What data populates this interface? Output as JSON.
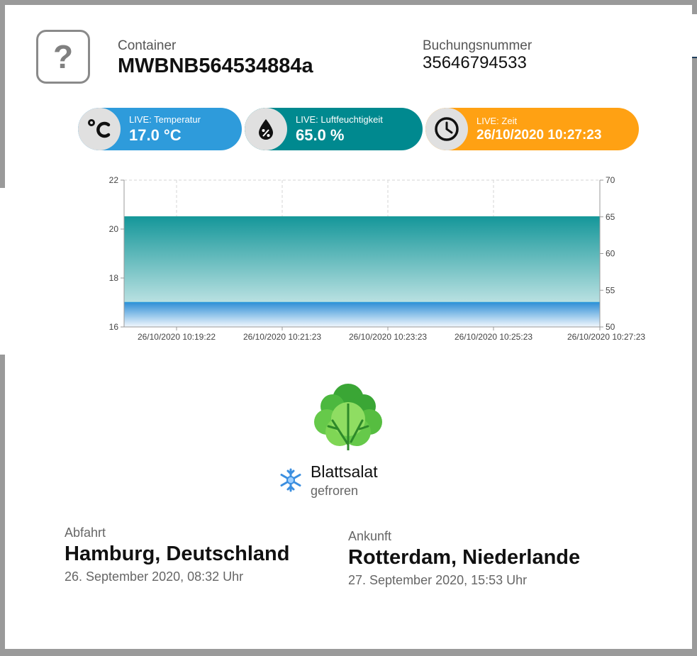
{
  "header": {
    "container_label": "Container",
    "container_value": "MWBNB564534884a",
    "booking_label": "Buchungsnummer",
    "booking_value": "35646794533",
    "unknown_icon": "question-mark-icon"
  },
  "live": {
    "temperature": {
      "label": "LIVE: Temperatur",
      "value": "17.0 °C",
      "icon": "celsius-icon",
      "color": "#2e9bdb"
    },
    "humidity": {
      "label": "LIVE: Luftfeuchtigkeit",
      "value": "65.0 %",
      "icon": "humidity-drop-icon",
      "color": "#00898f"
    },
    "time": {
      "label": "LIVE: Zeit",
      "value": "26/10/2020 10:27:23",
      "icon": "clock-icon",
      "color": "#ffa113"
    }
  },
  "chart_data": {
    "type": "area",
    "x": [
      "26/10/2020 10:19:22",
      "26/10/2020 10:21:23",
      "26/10/2020 10:23:23",
      "26/10/2020 10:25:23",
      "26/10/2020 10:27:23"
    ],
    "y_left_ticks": [
      "16",
      "18",
      "20",
      "22"
    ],
    "y_right_ticks": [
      "50",
      "55",
      "60",
      "65",
      "70"
    ],
    "ylim_left": [
      16,
      22
    ],
    "ylim_right": [
      50,
      70
    ],
    "series": [
      {
        "axis": "right",
        "values": [
          65,
          65,
          65,
          65,
          65
        ],
        "color": "#1a9a9a"
      },
      {
        "axis": "left",
        "values": [
          17,
          17,
          17,
          17,
          17
        ],
        "color": "#2e9bdb"
      }
    ],
    "grid": true
  },
  "product": {
    "name": "Blattsalat",
    "state": "gefroren",
    "image": "lettuce-icon",
    "state_icon": "snowflake-icon"
  },
  "departure": {
    "label": "Abfahrt",
    "city": "Hamburg, Deutschland",
    "date": "26. September 2020, 08:32 Uhr"
  },
  "arrival": {
    "label": "Ankunft",
    "city": "Rotterdam, Niederlande",
    "date": "27. September 2020, 15:53 Uhr"
  }
}
